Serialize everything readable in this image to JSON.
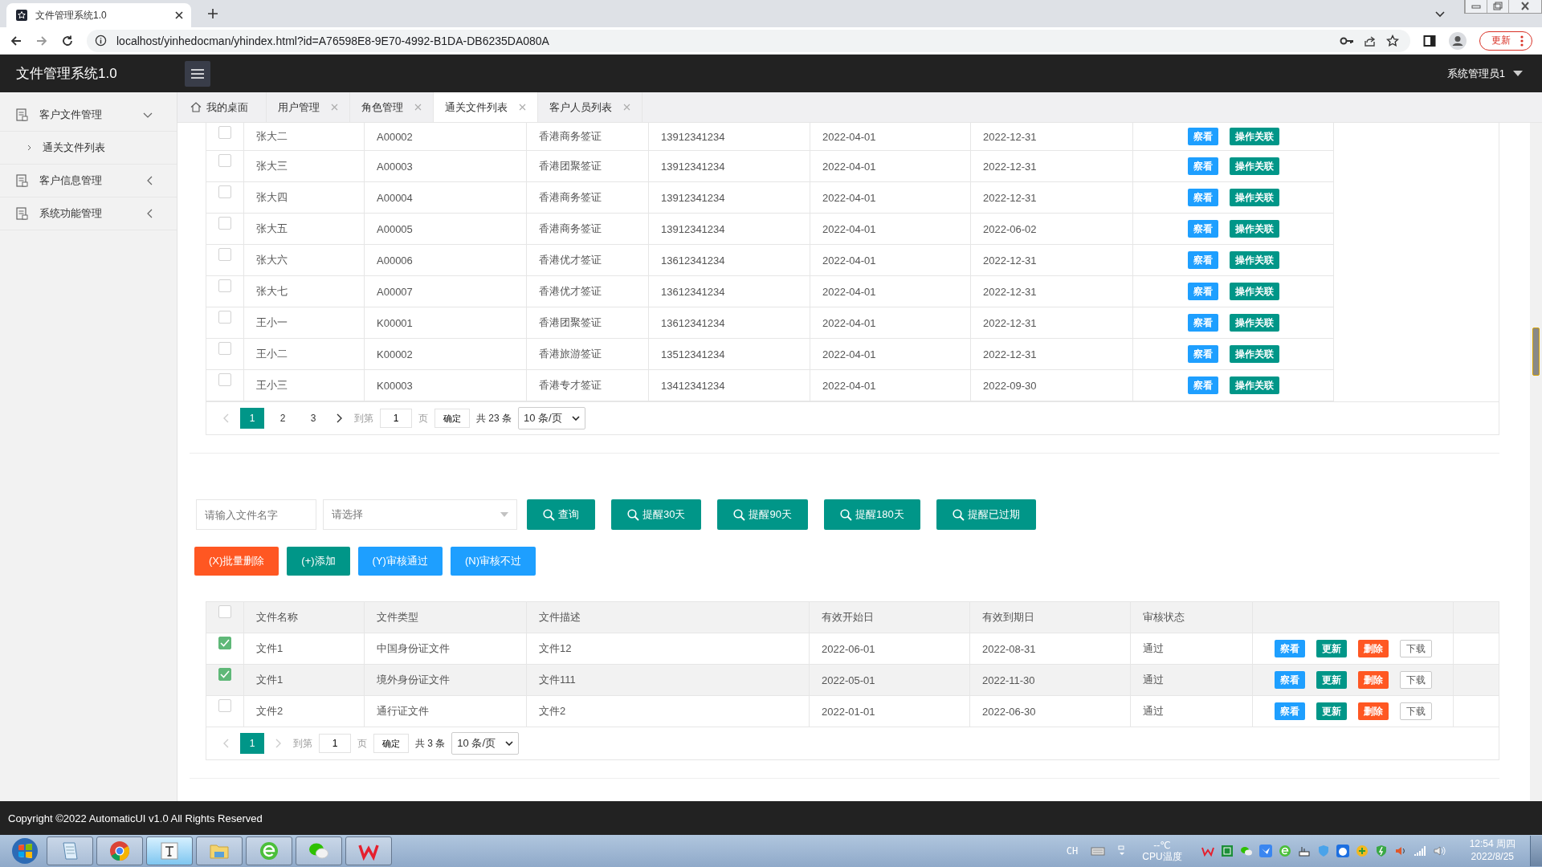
{
  "browser": {
    "tab_title": "文件管理系统1.0",
    "url": "localhost/yinhedocman/yhindex.html?id=A76598E8-9E70-4992-B1DA-DB6235DA080A",
    "update_button": "更新"
  },
  "header": {
    "title": "文件管理系统1.0",
    "user": "系统管理员1"
  },
  "sidebar": {
    "items": [
      {
        "label": "客户文件管理",
        "expanded": true,
        "children": [
          {
            "label": "通关文件列表"
          }
        ]
      },
      {
        "label": "客户信息管理",
        "expanded": false
      },
      {
        "label": "系统功能管理",
        "expanded": false
      }
    ]
  },
  "tabs": [
    {
      "label": "我的桌面",
      "kind": "home",
      "selected": false
    },
    {
      "label": "用户管理",
      "kind": "closable",
      "selected": false
    },
    {
      "label": "角色管理",
      "kind": "closable",
      "selected": false
    },
    {
      "label": "通关文件列表",
      "kind": "closable",
      "selected": true
    },
    {
      "label": "客户人员列表",
      "kind": "closable",
      "selected": false
    }
  ],
  "customer_table": {
    "rows": [
      {
        "checked": false,
        "cells": [
          "张大二",
          "A00002",
          "香港商务签证",
          "13912341234",
          "2022-04-01",
          "2022-12-31"
        ],
        "actions": [
          {
            "label": "察看",
            "kind": "info"
          },
          {
            "label": "操作关联",
            "kind": "primary"
          }
        ]
      },
      {
        "checked": false,
        "cells": [
          "张大三",
          "A00003",
          "香港团聚签证",
          "13912341234",
          "2022-04-01",
          "2022-12-31"
        ],
        "actions": [
          {
            "label": "察看",
            "kind": "info"
          },
          {
            "label": "操作关联",
            "kind": "primary"
          }
        ]
      },
      {
        "checked": false,
        "cells": [
          "张大四",
          "A00004",
          "香港商务签证",
          "13912341234",
          "2022-04-01",
          "2022-12-31"
        ],
        "actions": [
          {
            "label": "察看",
            "kind": "info"
          },
          {
            "label": "操作关联",
            "kind": "primary"
          }
        ]
      },
      {
        "checked": false,
        "cells": [
          "张大五",
          "A00005",
          "香港商务签证",
          "13912341234",
          "2022-04-01",
          "2022-06-02"
        ],
        "actions": [
          {
            "label": "察看",
            "kind": "info"
          },
          {
            "label": "操作关联",
            "kind": "primary"
          }
        ]
      },
      {
        "checked": false,
        "cells": [
          "张大六",
          "A00006",
          "香港优才签证",
          "13612341234",
          "2022-04-01",
          "2022-12-31"
        ],
        "actions": [
          {
            "label": "察看",
            "kind": "info"
          },
          {
            "label": "操作关联",
            "kind": "primary"
          }
        ]
      },
      {
        "checked": false,
        "cells": [
          "张大七",
          "A00007",
          "香港优才签证",
          "13612341234",
          "2022-04-01",
          "2022-12-31"
        ],
        "actions": [
          {
            "label": "察看",
            "kind": "info"
          },
          {
            "label": "操作关联",
            "kind": "primary"
          }
        ]
      },
      {
        "checked": false,
        "cells": [
          "王小一",
          "K00001",
          "香港团聚签证",
          "13612341234",
          "2022-04-01",
          "2022-12-31"
        ],
        "actions": [
          {
            "label": "察看",
            "kind": "info"
          },
          {
            "label": "操作关联",
            "kind": "primary"
          }
        ]
      },
      {
        "checked": false,
        "cells": [
          "王小二",
          "K00002",
          "香港旅游签证",
          "13512341234",
          "2022-04-01",
          "2022-12-31"
        ],
        "actions": [
          {
            "label": "察看",
            "kind": "info"
          },
          {
            "label": "操作关联",
            "kind": "primary"
          }
        ]
      },
      {
        "checked": false,
        "cells": [
          "王小三",
          "K00003",
          "香港专才签证",
          "13412341234",
          "2022-04-01",
          "2022-09-30"
        ],
        "actions": [
          {
            "label": "察看",
            "kind": "info"
          },
          {
            "label": "操作关联",
            "kind": "primary"
          }
        ]
      }
    ],
    "pagination": {
      "prev_disabled": true,
      "next_disabled": false,
      "pages": [
        {
          "label": "1",
          "selected": true
        },
        {
          "label": "2",
          "selected": false
        },
        {
          "label": "3",
          "selected": false
        }
      ],
      "goto_label": "到第",
      "page_value": "1",
      "page_unit": "页",
      "confirm": "确定",
      "total": "共 23 条",
      "page_size": "10 条/页"
    }
  },
  "filter": {
    "name_placeholder": "请输入文件名字",
    "select_placeholder": "请选择",
    "buttons": [
      "查询",
      "提醒30天",
      "提醒90天",
      "提醒180天",
      "提醒已过期"
    ]
  },
  "actions": [
    {
      "label": "(X)批量删除",
      "kind": "danger"
    },
    {
      "label": "(+)添加",
      "kind": "primary"
    },
    {
      "label": "(Y)审核通过",
      "kind": "info"
    },
    {
      "label": "(N)审核不过",
      "kind": "info"
    }
  ],
  "file_table": {
    "header_checked": false,
    "columns": [
      "文件名称",
      "文件类型",
      "文件描述",
      "有效开始日",
      "有效到期日",
      "审核状态"
    ],
    "rows": [
      {
        "checked": true,
        "cells": [
          "文件1",
          "中国身份证文件",
          "文件12",
          "2022-06-01",
          "2022-08-31",
          "通过"
        ],
        "actions": [
          {
            "label": "察看",
            "kind": "info"
          },
          {
            "label": "更新",
            "kind": "primary"
          },
          {
            "label": "删除",
            "kind": "danger"
          },
          {
            "label": "下载",
            "kind": "plain"
          }
        ]
      },
      {
        "checked": true,
        "cells": [
          "文件1",
          "境外身份证文件",
          "文件111",
          "2022-05-01",
          "2022-11-30",
          "通过"
        ],
        "actions": [
          {
            "label": "察看",
            "kind": "info"
          },
          {
            "label": "更新",
            "kind": "primary"
          },
          {
            "label": "删除",
            "kind": "danger"
          },
          {
            "label": "下载",
            "kind": "plain"
          }
        ]
      },
      {
        "checked": false,
        "cells": [
          "文件2",
          "通行证文件",
          "文件2",
          "2022-01-01",
          "2022-06-30",
          "通过"
        ],
        "actions": [
          {
            "label": "察看",
            "kind": "info"
          },
          {
            "label": "更新",
            "kind": "primary"
          },
          {
            "label": "删除",
            "kind": "danger"
          },
          {
            "label": "下载",
            "kind": "plain"
          }
        ]
      }
    ],
    "pagination": {
      "prev_disabled": true,
      "next_disabled": true,
      "pages": [
        {
          "label": "1",
          "selected": true
        }
      ],
      "goto_label": "到第",
      "page_value": "1",
      "page_unit": "页",
      "confirm": "确定",
      "total": "共 3 条",
      "page_size": "10 条/页"
    }
  },
  "footer": "Copyright ©2022 AutomaticUI v1.0 All Rights Reserved",
  "taskbar": {
    "apps": [
      {
        "kind": "notepad",
        "selected": false
      },
      {
        "kind": "chrome",
        "selected": false
      },
      {
        "kind": "typora",
        "selected": true
      },
      {
        "kind": "explorer",
        "selected": false
      },
      {
        "kind": "ie",
        "selected": false
      },
      {
        "kind": "wechat",
        "selected": false
      },
      {
        "kind": "wps",
        "selected": false
      }
    ],
    "tray": {
      "lang": "CH",
      "temp": "--℃",
      "temp_label": "CPU温度",
      "time": "12:54 周四",
      "date": "2022/8/25"
    }
  }
}
